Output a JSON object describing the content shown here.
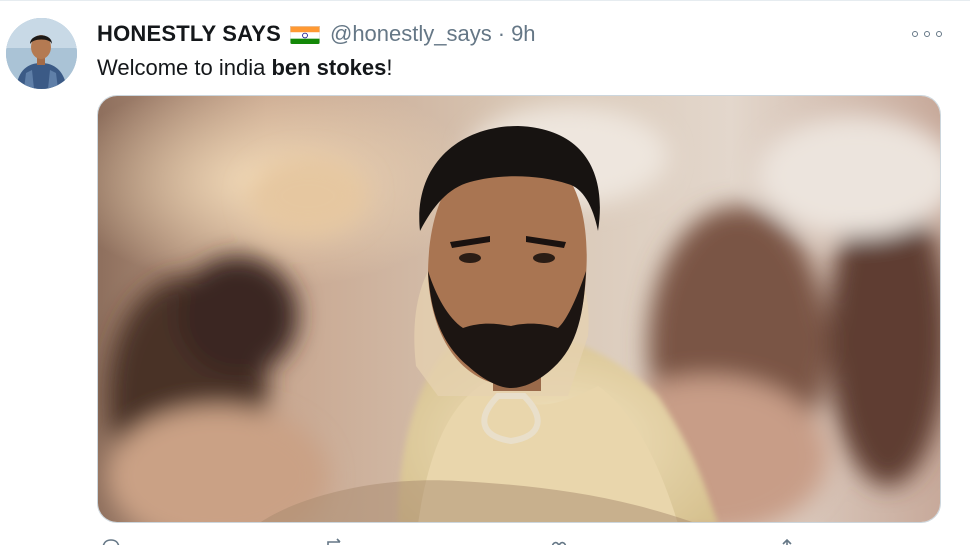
{
  "tweet": {
    "display_name": "HONESTLY SAYS",
    "handle": "@honestly_says",
    "separator": "·",
    "time": "9h",
    "text_prefix": "Welcome to india ",
    "text_bold": "ben stokes",
    "text_suffix": "!",
    "flag_icon": "india-flag",
    "more_icon": "more-options"
  },
  "colors": {
    "name": "#14171a",
    "secondary": "#657786",
    "border": "#ccd6dd"
  }
}
